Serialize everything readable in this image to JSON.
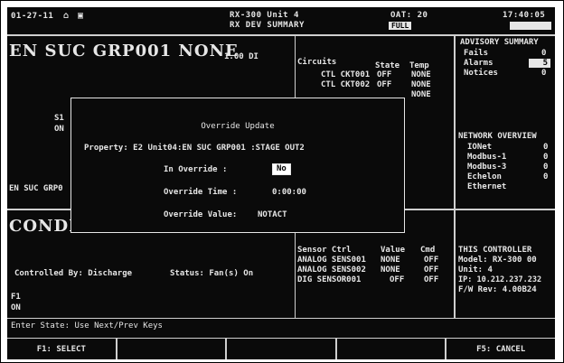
{
  "topbar": {
    "date": "01-27-11",
    "unit_name": "RX-300 Unit 4",
    "screen_name": "RX DEV SUMMARY",
    "oat": "OAT:  20",
    "full_badge": "FULL",
    "time": "17:40:05"
  },
  "group_panel": {
    "title": "EN SUC GRP001  NONE",
    "value": "1.00 DI",
    "mid_label_1": "S1",
    "mid_label_2": "ON",
    "footer_label": "EN SUC GRP0"
  },
  "circuits_panel": {
    "headers": [
      "Circuits",
      "State",
      "Temp"
    ],
    "rows": [
      [
        "CTL CKT001",
        "OFF",
        "NONE"
      ],
      [
        "CTL CKT002",
        "OFF",
        "NONE"
      ],
      [
        "",
        "",
        "NONE"
      ]
    ]
  },
  "advisory": {
    "title": "ADVISORY SUMMARY",
    "rows": [
      {
        "label": "Fails",
        "value": "0"
      },
      {
        "label": "Alarms",
        "value": "5"
      },
      {
        "label": "Notices",
        "value": "0"
      }
    ]
  },
  "network": {
    "title": "NETWORK OVERVIEW",
    "rows": [
      {
        "label": "IONet",
        "value": "0"
      },
      {
        "label": "Modbus-1",
        "value": "0"
      },
      {
        "label": "Modbus-3",
        "value": "0"
      },
      {
        "label": "Echelon",
        "value": "0"
      },
      {
        "label": "Ethernet",
        "value": ""
      }
    ]
  },
  "condenser_panel": {
    "title": "CONDEN",
    "controlled_by": "Controlled By: Discharge",
    "status": "Status: Fan(s) On",
    "label_1": "F1",
    "label_2": "ON"
  },
  "sensor_panel": {
    "headers": [
      "Sensor Ctrl",
      "Value",
      "Cmd"
    ],
    "rows": [
      [
        "ANALOG SENS001",
        "NONE",
        "OFF"
      ],
      [
        "ANALOG SENS002",
        "NONE",
        "OFF"
      ],
      [
        "DIG SENSOR001",
        "OFF",
        "OFF"
      ]
    ]
  },
  "controller": {
    "title": "THIS CONTROLLER",
    "model": "Model: RX-300  00",
    "unit": "Unit: 4",
    "ip": "IP: 10.212.237.232",
    "fw": "F/W Rev: 4.00B24"
  },
  "dialog": {
    "title": "Override Update",
    "property": "Property:  E2 Unit04:EN SUC GRP001 :STAGE OUT2",
    "in_override_label": "In Override   :",
    "in_override_value": "No",
    "override_time_label": "Override Time :",
    "override_time_value": "0:00:00",
    "override_value_label": "Override Value:",
    "override_value_value": "NOTACT"
  },
  "status_line": "Enter State:  Use Next/Prev Keys",
  "function_keys": [
    "F1: SELECT",
    "",
    "",
    "",
    "F5: CANCEL"
  ]
}
